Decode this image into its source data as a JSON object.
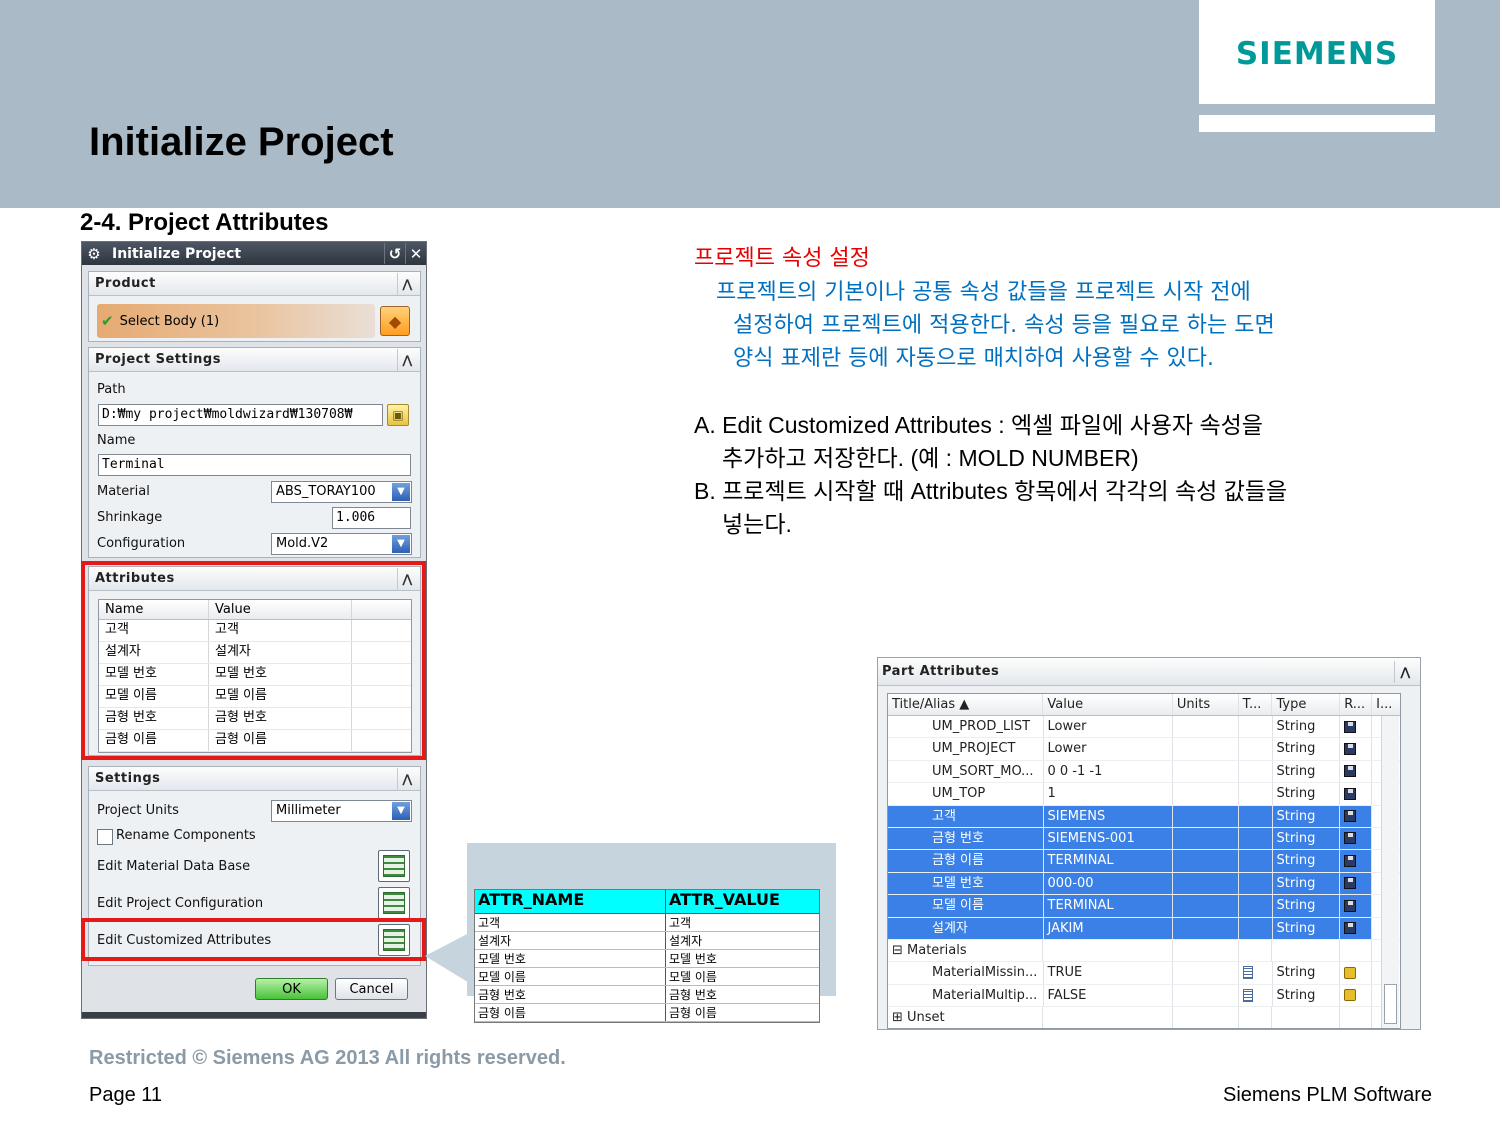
{
  "header": {
    "logo": "SIEMENS",
    "title": "Initialize Project",
    "subtitle": "2-4. Project Attributes"
  },
  "dialog": {
    "title": "Initialize Project",
    "product": {
      "header": "Product",
      "select_body": "Select Body (1)"
    },
    "project_settings": {
      "header": "Project Settings",
      "path_label": "Path",
      "path_value": "D:₩my project₩moldwizard₩130708₩",
      "name_label": "Name",
      "name_value": "Terminal",
      "material_label": "Material",
      "material_value": "ABS_TORAY100",
      "shrinkage_label": "Shrinkage",
      "shrinkage_value": "1.006",
      "configuration_label": "Configuration",
      "configuration_value": "Mold.V2"
    },
    "attributes": {
      "header": "Attributes",
      "columns": [
        "Name",
        "Value"
      ],
      "rows": [
        [
          "고객",
          "고객"
        ],
        [
          "설계자",
          "설계자"
        ],
        [
          "모델 번호",
          "모델 번호"
        ],
        [
          "모델 이름",
          "모델 이름"
        ],
        [
          "금형 번호",
          "금형 번호"
        ],
        [
          "금형 이름",
          "금형 이름"
        ]
      ]
    },
    "settings": {
      "header": "Settings",
      "units_label": "Project Units",
      "units_value": "Millimeter",
      "rename_components": "Rename Components",
      "edit_material": "Edit Material Data Base",
      "edit_config": "Edit Project Configuration",
      "edit_attributes": "Edit Customized Attributes"
    },
    "ok": "OK",
    "cancel": "Cancel"
  },
  "excel": {
    "columns": [
      "ATTR_NAME",
      "ATTR_VALUE"
    ],
    "rows": [
      [
        "고객",
        "고객"
      ],
      [
        "설계자",
        "설계자"
      ],
      [
        "모델 번호",
        "모델 번호"
      ],
      [
        "모델 이름",
        "모델 이름"
      ],
      [
        "금형 번호",
        "금형 번호"
      ],
      [
        "금형 이름",
        "금형 이름"
      ]
    ]
  },
  "description": {
    "heading": "프로젝트 속성 설정",
    "line1": "프로젝트의 기본이나 공통 속성 값들을 프로젝트 시작 전에",
    "line2": "설정하여  프로젝트에 적용한다. 속성 등을 필요로 하는 도면",
    "line3": "양식 표제란 등에 자동으로 매치하여 사용할 수 있다.",
    "a1": "A.  Edit Customized  Attributes : 엑셀 파일에 사용자 속성을",
    "a2": "추가하고 저장한다. (예 : MOLD NUMBER)",
    "b1": "B. 프로젝트 시작할 때 Attributes 항목에서 각각의 속성 값들을",
    "b2": "넣는다."
  },
  "part_attributes": {
    "header": "Part Attributes",
    "columns": [
      "Title/Alias",
      "Value",
      "Units",
      "T...",
      "Type",
      "R...",
      "I..."
    ],
    "rows": [
      {
        "title": "UM_PROD_LIST",
        "value": "Lower",
        "type": "String",
        "sel": false,
        "icon": "disk"
      },
      {
        "title": "UM_PROJECT",
        "value": "Lower",
        "type": "String",
        "sel": false,
        "icon": "disk"
      },
      {
        "title": "UM_SORT_MO...",
        "value": "0 0 -1 -1",
        "type": "String",
        "sel": false,
        "icon": "disk"
      },
      {
        "title": "UM_TOP",
        "value": "1",
        "type": "String",
        "sel": false,
        "icon": "disk"
      },
      {
        "title": "고객",
        "value": "SIEMENS",
        "type": "String",
        "sel": true,
        "icon": "disk"
      },
      {
        "title": "금형 번호",
        "value": "SIEMENS-001",
        "type": "String",
        "sel": true,
        "icon": "disk"
      },
      {
        "title": "금형 이름",
        "value": "TERMINAL",
        "type": "String",
        "sel": true,
        "icon": "disk"
      },
      {
        "title": "모델 번호",
        "value": "000-00",
        "type": "String",
        "sel": true,
        "icon": "disk"
      },
      {
        "title": "모델 이름",
        "value": "TERMINAL",
        "type": "String",
        "sel": true,
        "icon": "disk"
      },
      {
        "title": "설계자",
        "value": "JAKIM",
        "type": "String",
        "sel": true,
        "icon": "disk"
      }
    ],
    "materials_group": "Materials",
    "material_rows": [
      {
        "title": "MaterialMissin...",
        "value": "TRUE",
        "type": "String"
      },
      {
        "title": "MaterialMultip...",
        "value": "FALSE",
        "type": "String"
      }
    ],
    "unset_group": "Unset"
  },
  "footer": {
    "restricted": "Restricted © Siemens AG 2013 All rights reserved.",
    "page": "Page 11",
    "company": "Siemens PLM Software"
  },
  "colors": {
    "band": "#aabbc7",
    "brand": "#009999",
    "heading_red": "#e60000",
    "body_blue": "#0070c0",
    "selection": "#3a80e6",
    "highlight_box": "#e61919"
  }
}
